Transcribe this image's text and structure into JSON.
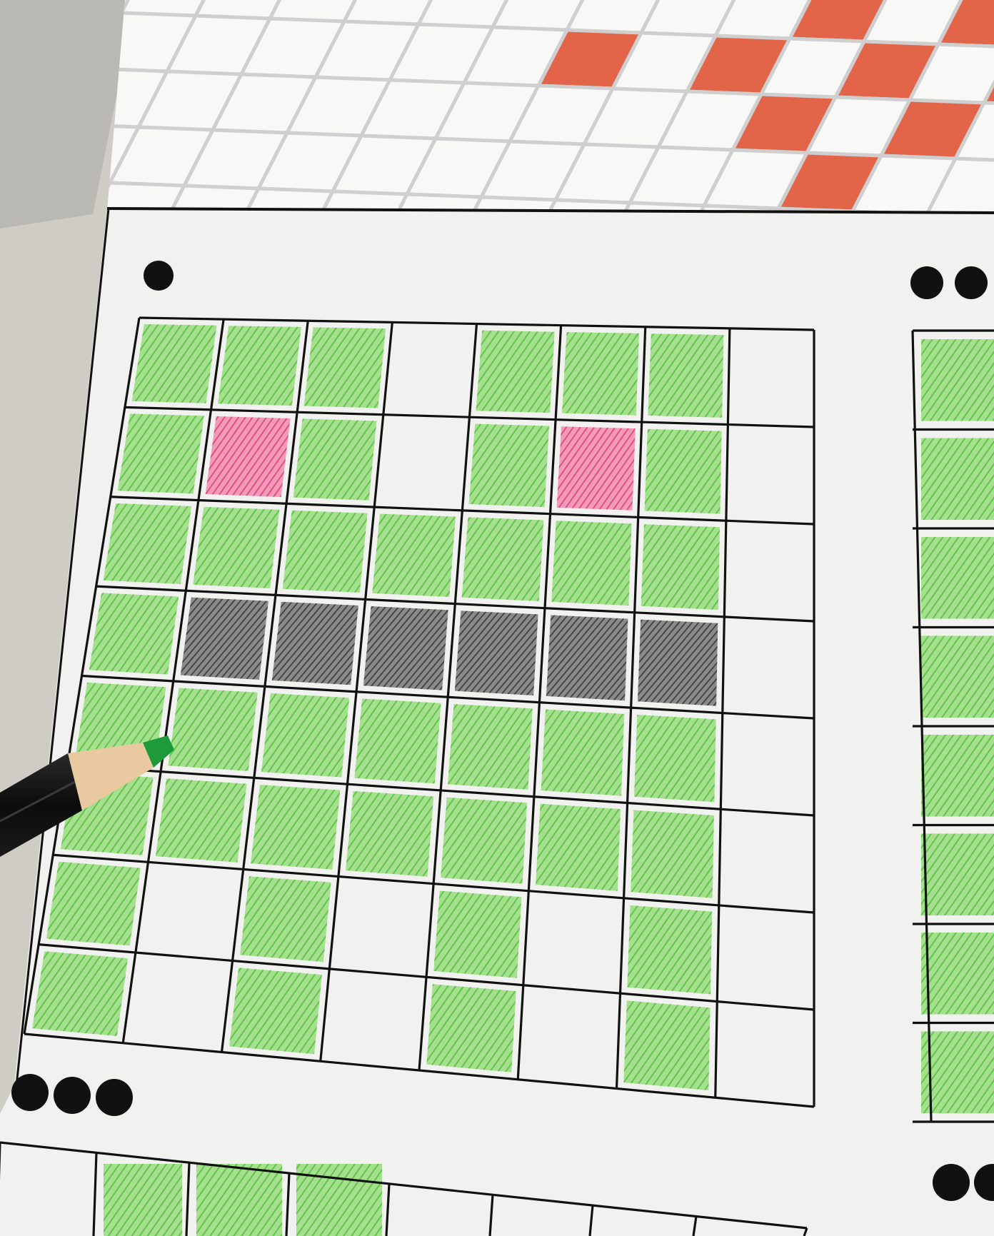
{
  "scene": {
    "description_free": true,
    "colors": {
      "green": "#8fd67a",
      "green_dark": "#5cbf47",
      "pink": "#e8578c",
      "gray": "#5a5a5a",
      "top_tile_accent": "#e2654a",
      "paper": "#f1f1ef",
      "line": "#111111"
    }
  },
  "main_grid": {
    "rows": 8,
    "cols": 8,
    "cells": [
      [
        "g",
        "g",
        "g",
        "e",
        "g",
        "g",
        "g",
        "e"
      ],
      [
        "g",
        "p",
        "g",
        "e",
        "g",
        "p",
        "g",
        "e"
      ],
      [
        "g",
        "g",
        "g",
        "g",
        "g",
        "g",
        "g",
        "e"
      ],
      [
        "g",
        "k",
        "k",
        "k",
        "k",
        "k",
        "k",
        "e"
      ],
      [
        "g",
        "g",
        "g",
        "g",
        "g",
        "g",
        "g",
        "e"
      ],
      [
        "g",
        "g",
        "g",
        "g",
        "g",
        "g",
        "g",
        "e"
      ],
      [
        "g",
        "e",
        "g",
        "e",
        "g",
        "e",
        "g",
        "e"
      ],
      [
        "g",
        "e",
        "g",
        "e",
        "g",
        "e",
        "g",
        "e"
      ]
    ]
  },
  "markers": {
    "top_left_dots": 1,
    "top_right_dots": 2,
    "bottom_left_dots": 3,
    "bottom_right_dots": 2
  }
}
